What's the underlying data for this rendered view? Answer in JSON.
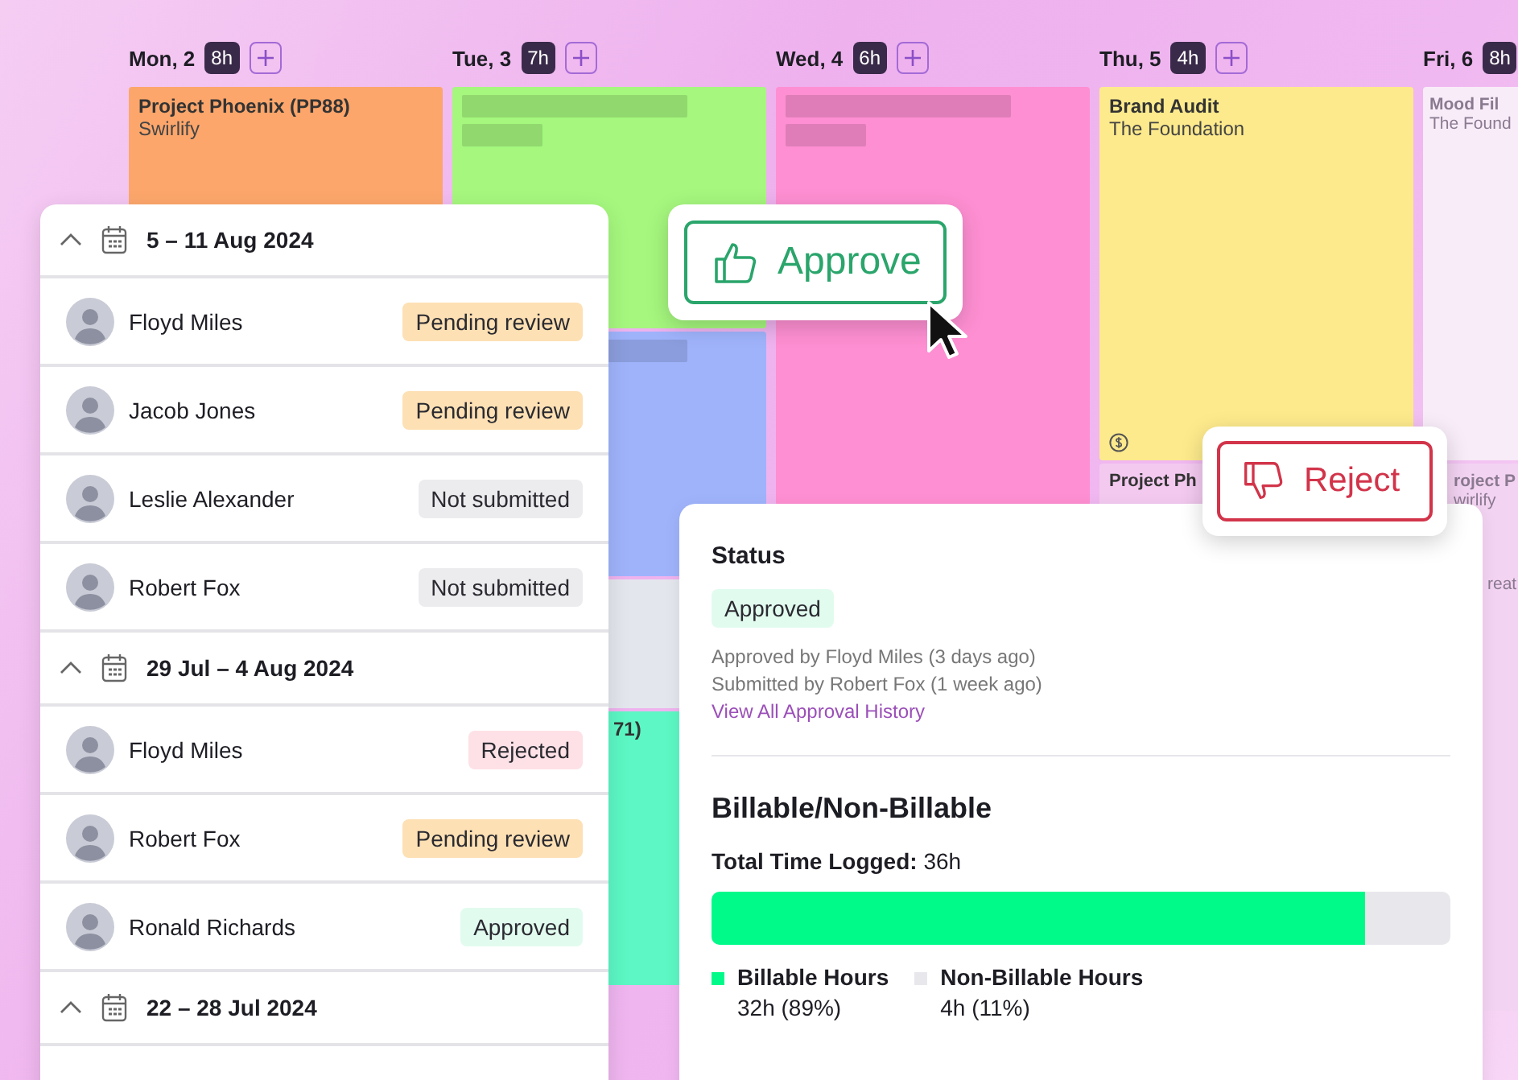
{
  "calendar": {
    "days": [
      {
        "label": "Mon, 2",
        "hours": "8h",
        "blocks": [
          {
            "kind": "text",
            "color": "#fca66b",
            "title": "Project Phoenix (PP88)",
            "client": "Swirlify"
          }
        ]
      },
      {
        "label": "Tue, 3",
        "hours": "7h",
        "blocks": [
          {
            "kind": "placeholder",
            "color": "#a5f77e"
          },
          {
            "kind": "placeholder",
            "color": "#9fb3fb"
          },
          {
            "kind": "empty",
            "color": "#e4e6ee"
          },
          {
            "kind": "text",
            "color": "#5cf7c4",
            "title": "71)"
          }
        ]
      },
      {
        "label": "Wed, 4",
        "hours": "6h",
        "blocks": [
          {
            "kind": "placeholder",
            "color": "#fe8fd2"
          }
        ]
      },
      {
        "label": "Thu, 5",
        "hours": "4h",
        "blocks": [
          {
            "kind": "text",
            "color": "#fdea8c",
            "title": "Brand Audit",
            "client": "The Foundation",
            "billable": true
          },
          {
            "kind": "text",
            "color": "#f3c9f0",
            "title": "Project Ph"
          }
        ]
      },
      {
        "label": "Fri, 6",
        "hours": "8h",
        "blocks": [
          {
            "kind": "text",
            "color": "#f8ecf8",
            "title": "Mood Fil",
            "client": "The Found"
          },
          {
            "kind": "text",
            "color": "#f3d3f2",
            "title": "roject P",
            "client": "wirlify",
            "note": "reat"
          }
        ]
      }
    ]
  },
  "timesheets": [
    {
      "range": "5 – 11 Aug 2024",
      "expanded": true,
      "rows": [
        {
          "name": "Floyd Miles",
          "status": "Pending review",
          "kind": "pending"
        },
        {
          "name": "Jacob Jones",
          "status": "Pending review",
          "kind": "pending"
        },
        {
          "name": "Leslie Alexander",
          "status": "Not submitted",
          "kind": "not_submitted"
        },
        {
          "name": "Robert Fox",
          "status": "Not submitted",
          "kind": "not_submitted"
        }
      ]
    },
    {
      "range": "29 Jul – 4 Aug 2024",
      "expanded": true,
      "rows": [
        {
          "name": "Floyd Miles",
          "status": "Rejected",
          "kind": "rejected"
        },
        {
          "name": "Robert Fox",
          "status": "Pending review",
          "kind": "pending"
        },
        {
          "name": "Ronald Richards",
          "status": "Approved",
          "kind": "approved"
        }
      ]
    },
    {
      "range": "22 – 28 Jul 2024",
      "expanded": true
    }
  ],
  "approve_button": {
    "label": "Approve"
  },
  "reject_button": {
    "label": "Reject"
  },
  "status_panel": {
    "heading": "Status",
    "status": "Approved",
    "lines": [
      "Approved by Floyd Miles (3 days ago)",
      "Submitted by Robert Fox (1 week ago)"
    ],
    "link": "View All Approval History",
    "billing": {
      "title": "Billable/Non-Billable",
      "total": "**Total Time Logged:** 36h",
      "level": 0.885,
      "legend": [
        {
          "label": "Billable Hours",
          "value": "32h (89%)",
          "color": "#00fa8a"
        },
        {
          "label": "Non-Billable Hours",
          "value": "4h (11%)",
          "color": "#e8e8ec"
        }
      ]
    }
  }
}
